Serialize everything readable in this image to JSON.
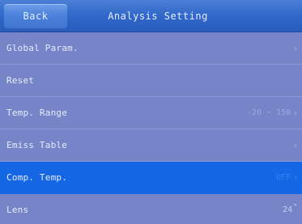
{
  "header": {
    "back_label": "Back",
    "title": "Analysis Setting"
  },
  "menu": {
    "global_param": {
      "label": "Global Param.",
      "chevron": "›"
    },
    "reset": {
      "label": "Reset"
    },
    "temp_range": {
      "label": "Temp. Range",
      "value": "-20 ~ 150",
      "chevron": "›"
    },
    "emiss_table": {
      "label": "Emiss Table",
      "chevron": "›"
    },
    "comp_temp": {
      "label": "Comp. Temp.",
      "value": "OFF",
      "chevron": "›",
      "selected": true
    },
    "lens": {
      "label": "Lens",
      "value": "24",
      "degree": "°"
    }
  },
  "colors": {
    "background": "#7585c8",
    "header": "#2f66c8",
    "selected_row": "#1567e6",
    "text": "#e8ecfb"
  },
  "icons": {
    "row_arrow": "chevron-right-icon"
  }
}
